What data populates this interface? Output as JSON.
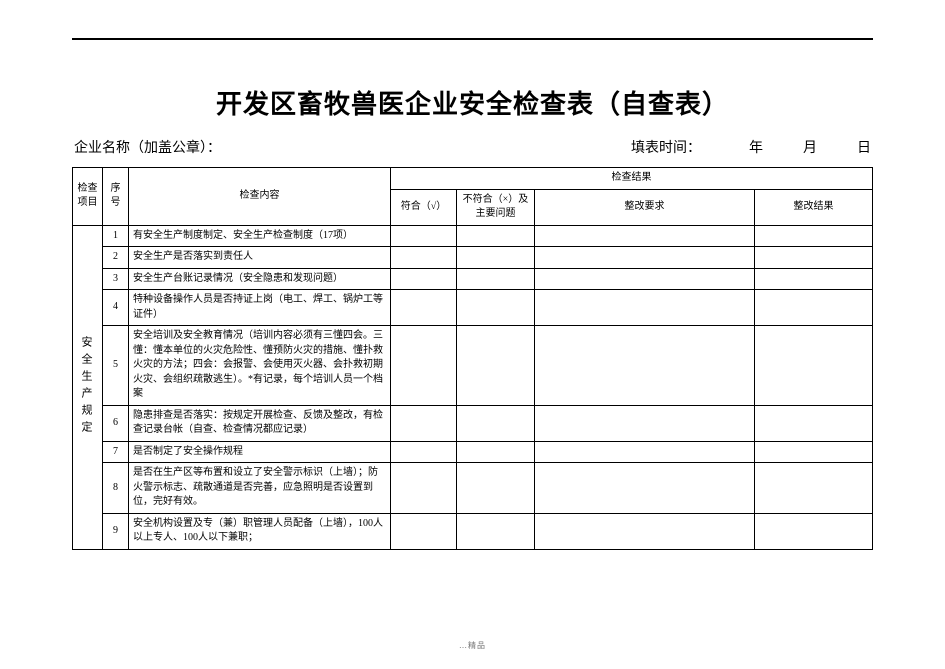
{
  "title": "开发区畜牧兽医企业安全检查表（自查表）",
  "meta": {
    "company_label": "企业名称（加盖公章）：",
    "date_label": "填表时间：",
    "year_unit": "年",
    "month_unit": "月",
    "day_unit": "日"
  },
  "headers": {
    "category": "检查项目",
    "index": "序号",
    "content": "检查内容",
    "result_group": "检查结果",
    "conform": "符合（√）",
    "not_conform": "不符合（×）及主要问题",
    "rectify_req": "整改要求",
    "rectify_res": "整改结果"
  },
  "category_label": "安全生产规定",
  "rows": [
    {
      "idx": "1",
      "content": "有安全生产制度制定、安全生产检查制度（17项）"
    },
    {
      "idx": "2",
      "content": "安全生产是否落实到责任人"
    },
    {
      "idx": "3",
      "content": "安全生产台账记录情况（安全隐患和发现问题）"
    },
    {
      "idx": "4",
      "content": "特种设备操作人员是否持证上岗（电工、焊工、锅炉工等证件）"
    },
    {
      "idx": "5",
      "content": "安全培训及安全教育情况（培训内容必须有三懂四会。三懂：懂本单位的火灾危险性、懂预防火灾的措施、懂扑救火灾的方法；四会：会报警、会使用灭火器、会扑救初期火灾、会组织疏散逃生）。*有记录，每个培训人员一个档案"
    },
    {
      "idx": "6",
      "content": "隐患排查是否落实：按规定开展检查、反馈及整改，有检查记录台帐（自查、检查情况都应记录）"
    },
    {
      "idx": "7",
      "content": "是否制定了安全操作规程"
    },
    {
      "idx": "8",
      "content": "是否在生产区等布置和设立了安全警示标识（上墙）；防火警示标志、疏散通道是否完善，应急照明是否设置到位，完好有效。"
    },
    {
      "idx": "9",
      "content": "安全机构设置及专（兼）职管理人员配备（上墙），100人以上专人、100人以下兼职；"
    }
  ],
  "footer": "…精品"
}
